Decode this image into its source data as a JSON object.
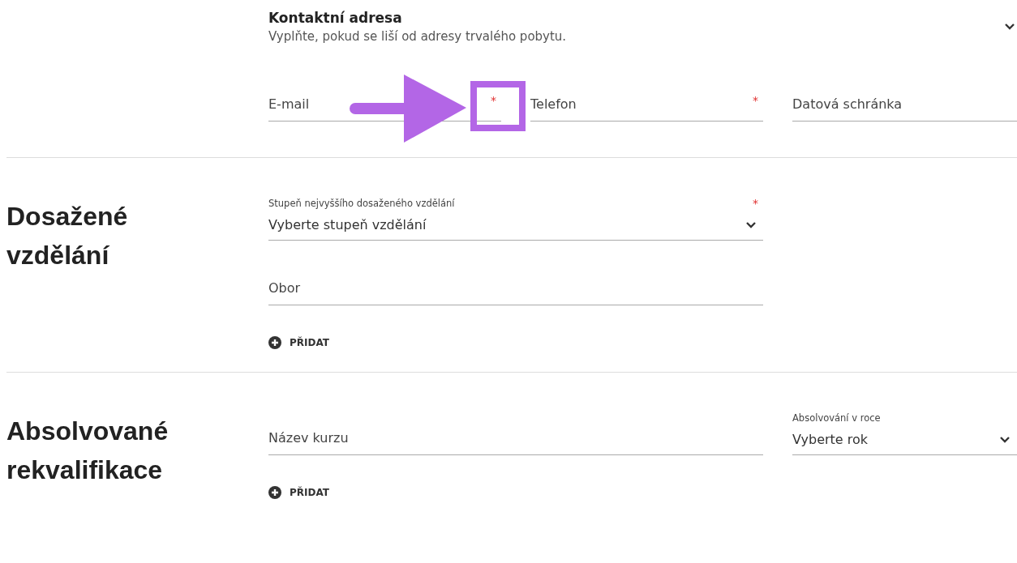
{
  "contact_section": {
    "title": "Kontaktní adresa",
    "subtitle": "Vyplňte, pokud se liší od adresy trvalého pobytu.",
    "expanded": true,
    "fields": [
      {
        "placeholder": "E-mail",
        "required_mark": "*"
      },
      {
        "placeholder": "Telefon",
        "required_mark": "*"
      },
      {
        "placeholder": "Datová schránka"
      }
    ]
  },
  "sections": [
    {
      "heading": "Dosažené vzdělání",
      "rows": [
        {
          "kind": "wide-select",
          "label": "Stupeň nejvyššího dosaženého vzdělání",
          "value": "Vyberte stupeň vzdělání",
          "required_mark": "*"
        },
        {
          "kind": "wide-text",
          "placeholder": "Obor"
        }
      ],
      "add_button": "PŘIDAT"
    },
    {
      "heading": "Absolvované rekvalifikace",
      "rows": [
        {
          "kind": "wide-text",
          "placeholder": "Název kurzu"
        },
        {
          "kind": "select",
          "label": "Absolvování v roce",
          "value": "Vyberte rok"
        }
      ],
      "add_button": "PŘIDAT"
    }
  ]
}
